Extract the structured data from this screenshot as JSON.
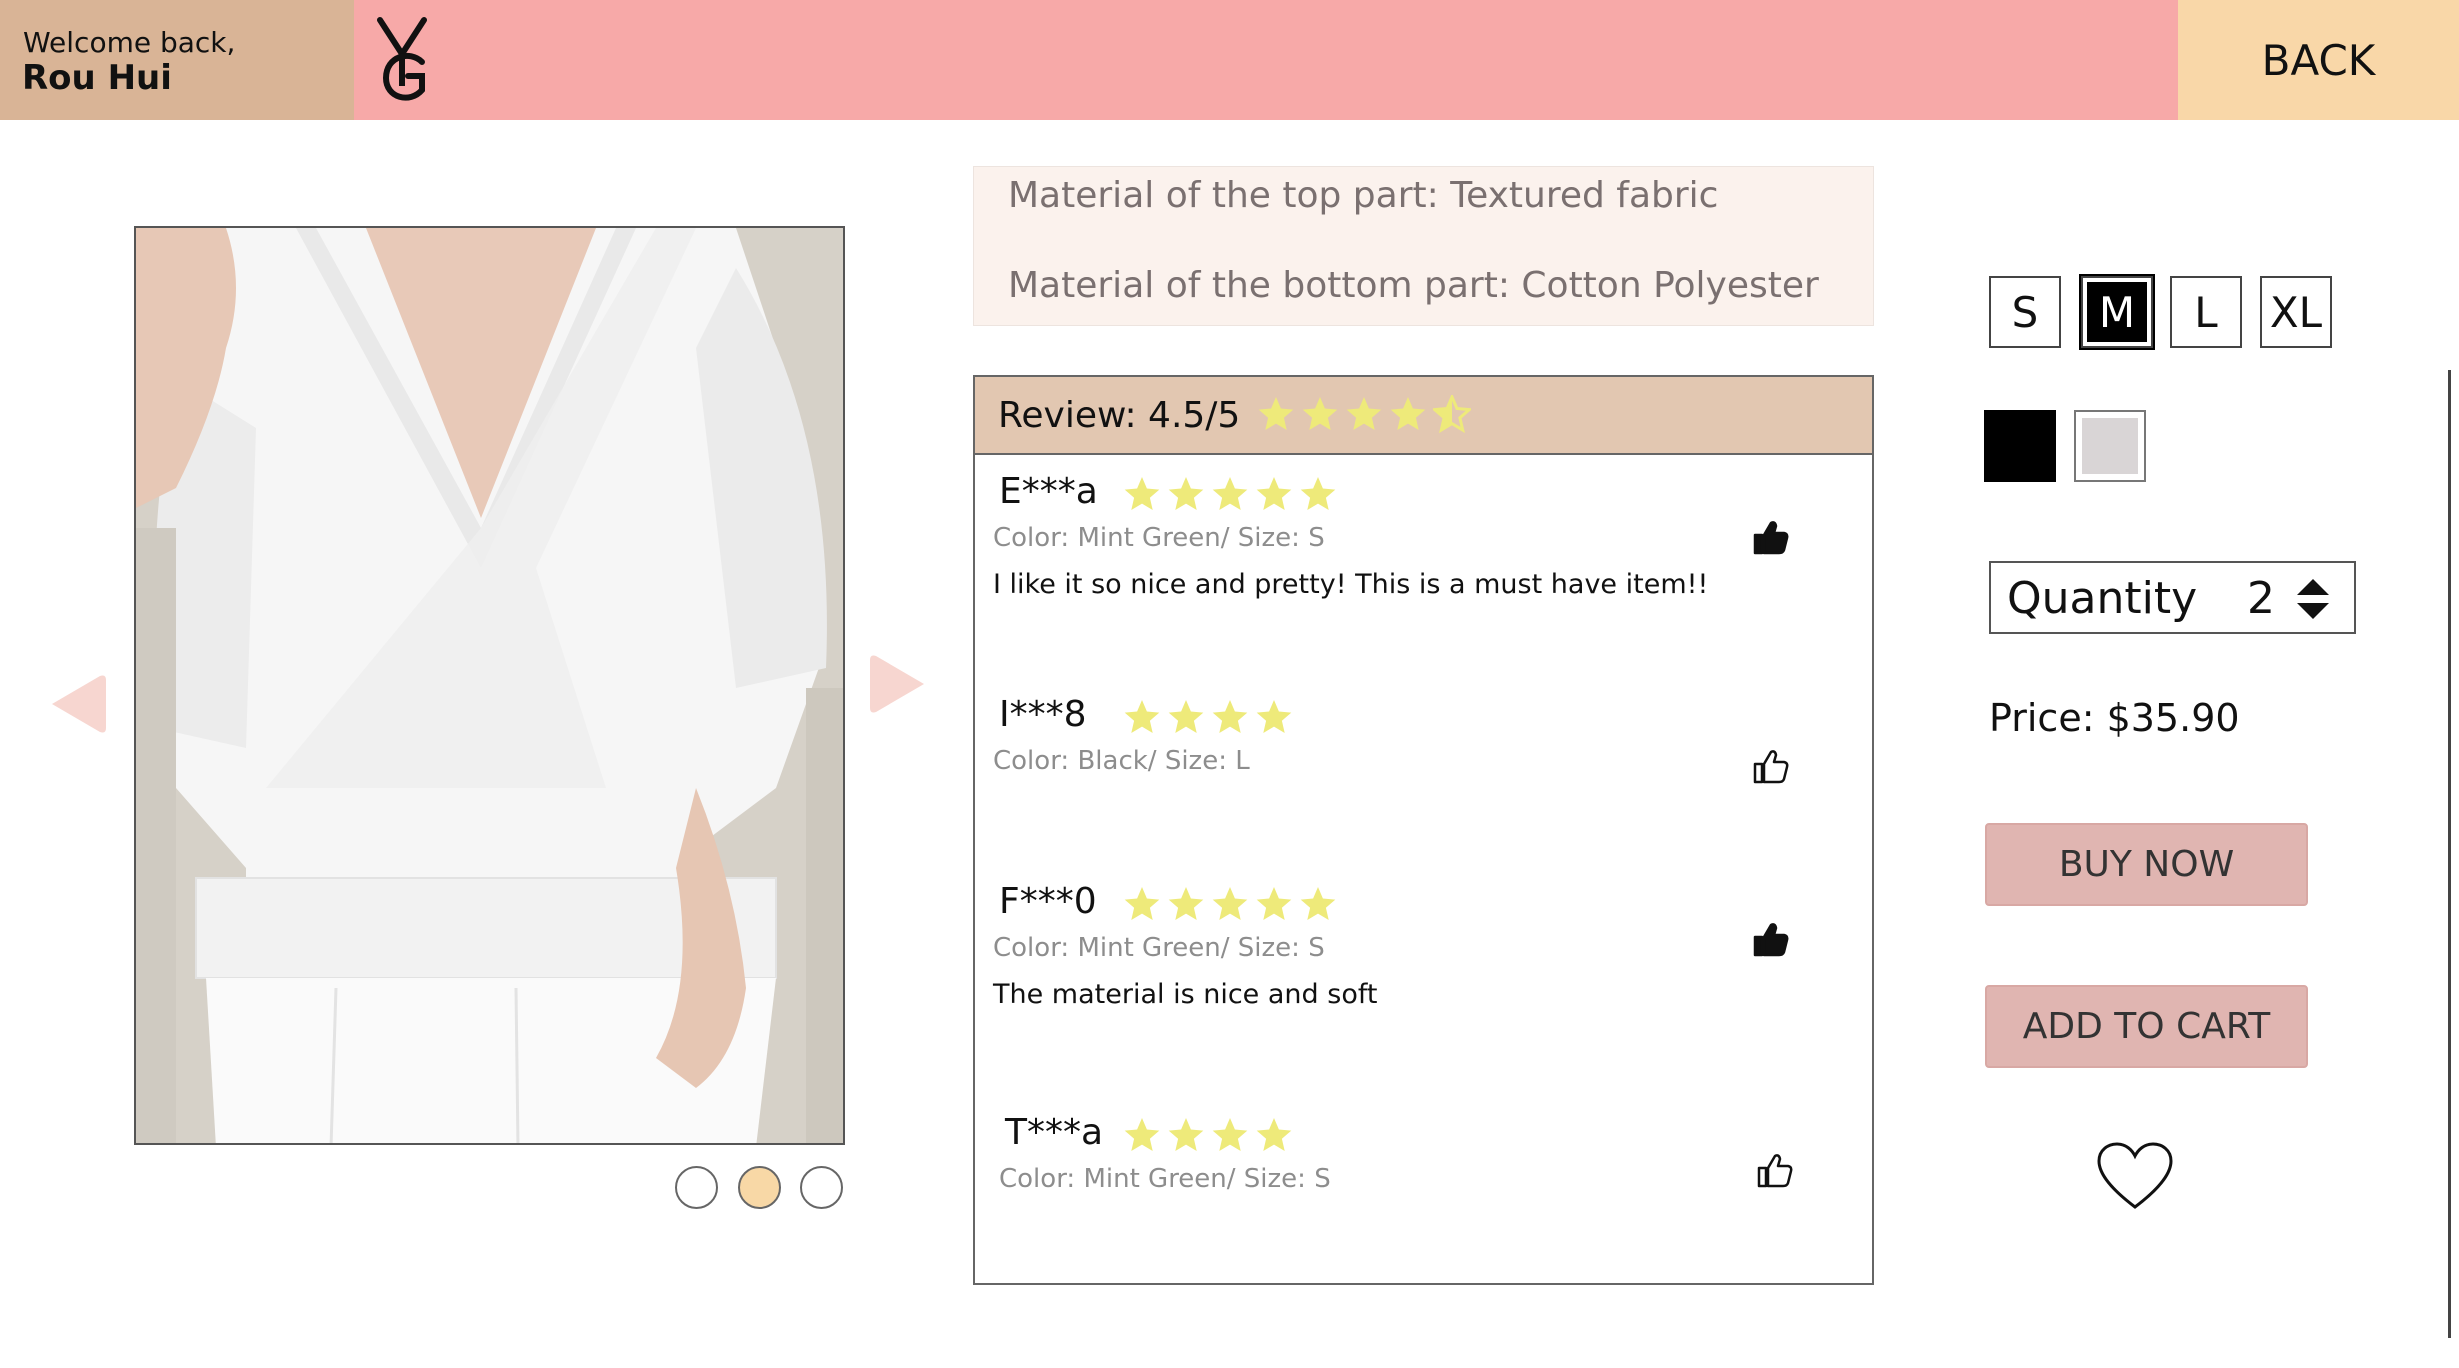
{
  "header": {
    "welcome_line": "Welcome back,",
    "user_name": "Rou  Hui",
    "logo_icon": "yg-monogram-logo",
    "back_label": "BACK"
  },
  "gallery": {
    "image_description_icon": "product-photo",
    "prev_icon": "triangle-left-icon",
    "next_icon": "triangle-right-icon",
    "dots": 3,
    "active_dot": 2
  },
  "material": {
    "top": "Material of the top part: Textured fabric",
    "bottom": "Material of the bottom part: Cotton Polyester"
  },
  "reviews": {
    "title": "Review: 4.5/5",
    "overall_rating": 4.5,
    "items": [
      {
        "name": "E***a",
        "rating": 5,
        "meta": "Color: Mint Green/ Size: S",
        "text": "I like it so nice and pretty! This is a must have item!!",
        "liked": true
      },
      {
        "name": "I***8",
        "rating": 4,
        "meta": "Color: Black/ Size: L",
        "text": "",
        "liked": false
      },
      {
        "name": "F***0",
        "rating": 5,
        "meta": "Color: Mint Green/ Size: S",
        "text": "The material is nice and soft",
        "liked": true
      },
      {
        "name": "T***a",
        "rating": 4,
        "meta": "Color: Mint Green/ Size: S",
        "text": "",
        "liked": false
      }
    ]
  },
  "options": {
    "sizes": [
      "S",
      "M",
      "L",
      "XL"
    ],
    "selected_size": "M",
    "colors": [
      "#000000",
      "#d9d5d6"
    ],
    "quantity_label": "Quantity",
    "quantity_value": "2",
    "price": "Price: $35.90",
    "buy_now": "BUY NOW",
    "add_to_cart": "ADD TO CART",
    "wishlist_icon": "heart-icon"
  },
  "colors": {
    "header_pink": "#f7a9a8",
    "welcome_tan": "#d9b496",
    "back_peach": "#f9d7a8",
    "star_yellow": "#eeea7a",
    "button_pink": "#e0b5b1"
  }
}
